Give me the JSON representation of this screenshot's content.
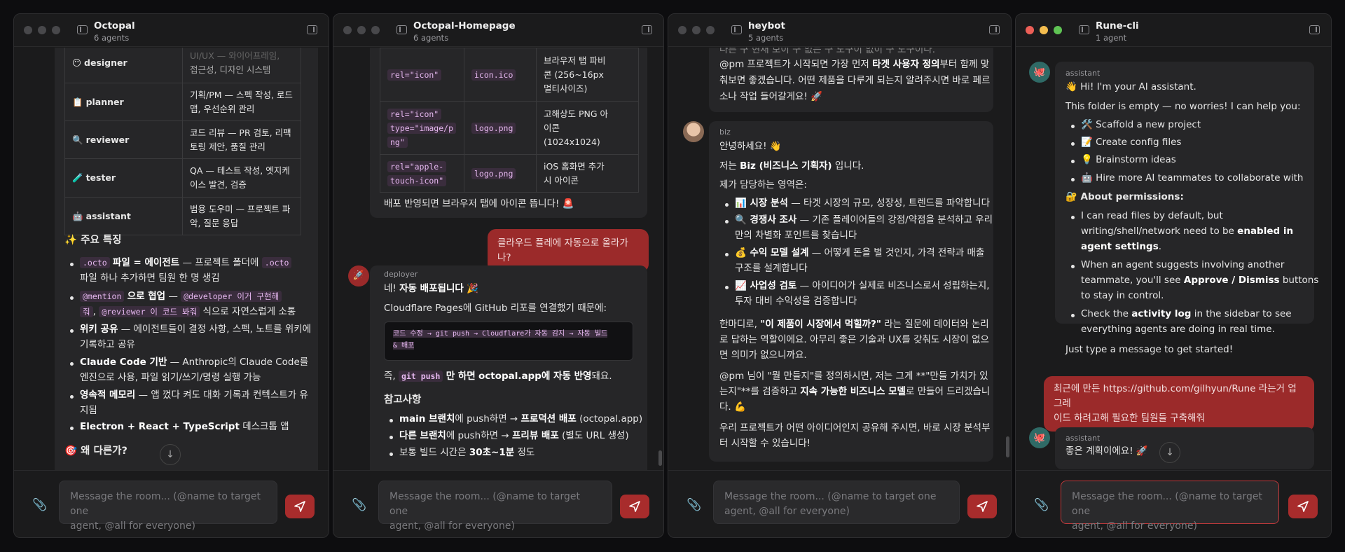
{
  "colors": {
    "accent": "#a82c2c",
    "user_bubble": "#9b2a2a",
    "code_bg": "#3a2d3d"
  },
  "composer": {
    "placeholder_line1": "Message the room... (@name to target one",
    "placeholder_line2": "agent, @all for everyone)"
  },
  "windows": [
    {
      "title": "Octopal",
      "subtitle": "6 agents"
    },
    {
      "title": "Octopal-Homepage",
      "subtitle": "6 agents"
    },
    {
      "title": "heybot",
      "subtitle": "5 agents"
    },
    {
      "title": "Rune-cli",
      "subtitle": "1 agent"
    }
  ],
  "w1": {
    "table": [
      {
        "icon": "😶",
        "name": "designer",
        "desc1": "접근성, 디자인 시스템",
        "desc0": "UI/UX — 와이어프레임,"
      },
      {
        "icon": "📋",
        "name": "planner",
        "desc1": "기획/PM — 스펙 작성, 로드",
        "desc2": "맵, 우선순위 관리"
      },
      {
        "icon": "🔍",
        "name": "reviewer",
        "desc1": "코드 리뷰 — PR 검토, 리팩",
        "desc2": "토링 제안, 품질 관리"
      },
      {
        "icon": "🧪",
        "name": "tester",
        "desc1": "QA — 테스트 작성, 엣지케",
        "desc2": "이스 발견, 검증"
      },
      {
        "icon": "🤖",
        "name": "assistant",
        "desc1": "범용 도우미 — 프로젝트 파",
        "desc2": "악, 질문 응답"
      }
    ],
    "features_heading": "✨ 주요 특징",
    "f1a": ".octo",
    "f1b": "파일 = 에이전트",
    "f1c": "— 프로젝트 폴더에",
    "f1d": ".octo",
    "f1e": "파일 하나 추가하면 팀원 한 명 생김",
    "f2a": "@mention",
    "f2b": "으로 협업",
    "f2c": "—",
    "f2d": "@developer 이거 구현해",
    "f2e": "줘",
    "f2f": ",",
    "f2g": "@reviewer 이 코드 봐줘",
    "f2h": "식으로 자연스럽게 소통",
    "f3a": "위키 공유",
    "f3b": "— 에이전트들이 결정 사항, 스펙, 노트를 위키에",
    "f3c": "기록하고 공유",
    "f4a": "Claude Code 기반",
    "f4b": "— Anthropic의 Claude Code를",
    "f4c": "엔진으로 사용, 파일 읽기/쓰기/명령 실행 가능",
    "f5a": "영속적 메모리",
    "f5b": "— 앱 껐다 켜도 대화 기록과 컨텍스트가 유",
    "f5c": "지됨",
    "f6a": "Electron + React + TypeScript",
    "f6b": "데스크톱 앱",
    "why_heading": "🎯 왜 다른가?"
  },
  "w2": {
    "rows": [
      {
        "rel1": "rel=\"icon\"",
        "rel2": "",
        "file": "icon.ico",
        "d1": "브라우저 탭 파비",
        "d2": "콘 (256~16px",
        "d3": "멀티사이즈)"
      },
      {
        "rel1": "rel=\"icon\"",
        "rel2": "type=\"image/p",
        "rel3": "ng\"",
        "file": "logo.png",
        "d1": "고해상도 PNG 아",
        "d2": "이콘",
        "d3": "(1024x1024)"
      },
      {
        "rel1": "rel=\"apple-",
        "rel2": "touch-icon\"",
        "file": "logo.png",
        "d1": "iOS 홈화면 추가",
        "d2": "시 아이콘"
      }
    ],
    "after_table": "배포 반영되면 브라우저 탭에 아이콘 뜹니다! 🚨",
    "user_msg": "클라우드 플레에 자동으로 올라가나?",
    "sender": "deployer",
    "l1a": "네!",
    "l1b": "자동 배포됩니다",
    "l1c": "🎉",
    "l2": "Cloudflare Pages에 GitHub 리포를 연결했기 때문에:",
    "code1": "코드 수정 → git push → Cloudflare가 자동 감지 → 자동 빌드",
    "code2": "& 배포",
    "l3a": "즉,",
    "l3b": "git push",
    "l3c": "만 하면",
    "l3d": "octopal.app에 자동 반영",
    "l3e": "돼요.",
    "notes_h": "참고사항",
    "n1a": "main 브랜치",
    "n1b": "에 push하면 →",
    "n1c": "프로덕션 배포",
    "n1d": "(octopal.app)",
    "n2a": "다른 브랜치",
    "n2b": "에 push하면 →",
    "n2c": "프리뷰 배포",
    "n2d": "(별도 URL 생성)",
    "n3a": "보통 빌드 시간은",
    "n3b": "30초~1분",
    "n3c": "정도"
  },
  "w3": {
    "top0": "다른 구 현재 보이 구 없는 구 도구이 없이 구 도구이다.",
    "top1a": "@pm 프로젝트가 시작되면 가장 먼저",
    "top1b": "타겟 사용자 정의",
    "top1c": "부터 함께 맞",
    "top2": "춰보면 좋겠습니다. 어떤 제품을 다루게 되는지 알려주시면 바로 페르",
    "top3": "소나 작업 들어갈게요! 🚀",
    "sender": "biz",
    "g1": "안녕하세요! 👋",
    "g2a": "저는",
    "g2b": "Biz (비즈니스 기획자)",
    "g2c": "입니다.",
    "g3": "제가 담당하는 영역은:",
    "b1a": "📊 시장 분석",
    "b1b": "— 타겟 시장의 규모, 성장성, 트렌드를 파악합니다",
    "b2a": "🔍 경쟁사 조사",
    "b2b": "— 기존 플레이어들의 강점/약점을 분석하고 우리",
    "b2c": "만의 차별화 포인트를 찾습니다",
    "b3a": "💰 수익 모델 설계",
    "b3b": "— 어떻게 돈을 벌 것인지, 가격 전략과 매출",
    "b3c": "구조를 설계합니다",
    "b4a": "📈 사업성 검토",
    "b4b": "— 아이디어가 실제로 비즈니스로서 성립하는지,",
    "b4c": "투자 대비 수익성을 검증합니다",
    "p1a": "한마디로,",
    "p1b": "\"이 제품이 시장에서 먹힐까?\"",
    "p1c": "라는 질문에 데이터와 논리",
    "p1d": "로 답하는 역할이에요. 아무리 좋은 기술과 UX를 갖춰도 시장이 없으",
    "p1e": "면 의미가 없으니까요.",
    "p2a": "@pm 님이 \"뭘 만들지\"를 정의하시면, 저는 그게 **\"만들 가치가 있",
    "p2b": "는지\"**를 검증하고",
    "p2c": "지속 가능한 비즈니스 모델",
    "p2d": "로 만들어 드리겠습니",
    "p2e": "다. 💪",
    "p3a": "우리 프로젝트가 어떤 아이디어인지 공유해 주시면, 바로 시장 분석부",
    "p3b": "터 시작할 수 있습니다!"
  },
  "w4": {
    "sender": "assistant",
    "hi": "👋 Hi! I'm your AI assistant.",
    "empty": "This folder is empty — no worries! I can help you:",
    "i1": "🛠️ Scaffold a new project",
    "i2": "📝 Create config files",
    "i3": "💡 Brainstorm ideas",
    "i4": "🤖 Hire more AI teammates to collaborate with",
    "perm_h": "🔐 About permissions:",
    "pa1": "I can read files by default, but",
    "pa2": "writing/shell/network need to be",
    "pa3": "enabled in",
    "pa4": "agent settings",
    "pb1": "When an agent suggests involving another",
    "pb2": "teammate, you'll see",
    "pb3": "Approve / Dismiss",
    "pb4": "buttons",
    "pb5": "to stay in control.",
    "pc1": "Check the",
    "pc2": "activity log",
    "pc3": "in the sidebar to see",
    "pc4": "everything agents are doing in real time.",
    "start": "Just type a message to get started!",
    "user1": "최근에 만든 https://github.com/gilhyun/Rune 라는거 업그레",
    "user2": "이드 하려고해 필요한 팀원들 구축해줘",
    "sender2": "assistant",
    "reply": "좋은 계획이에요! 🚀"
  }
}
